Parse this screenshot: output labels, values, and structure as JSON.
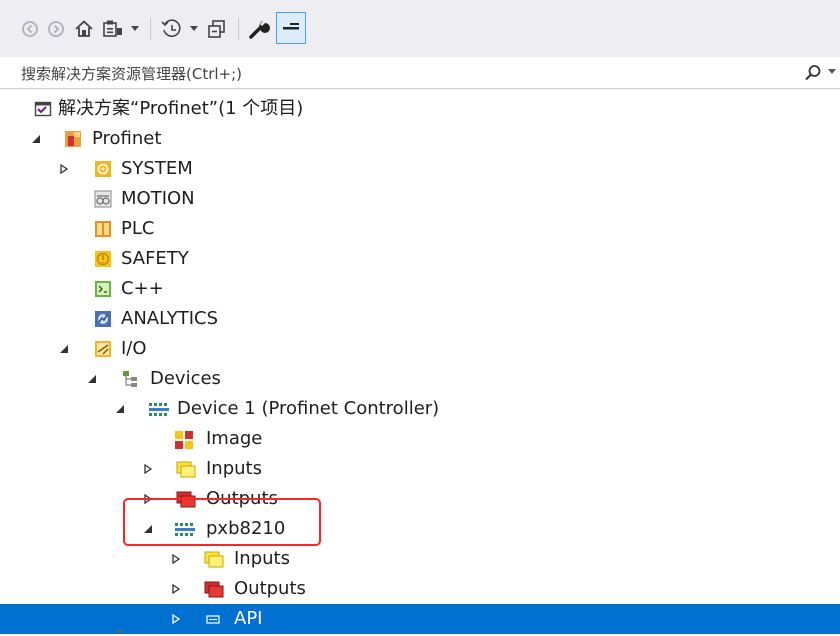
{
  "search": {
    "placeholder": "搜索解决方案资源管理器(Ctrl+;)"
  },
  "toolbar": {
    "buttons": [
      "back-icon",
      "forward-icon",
      "home-icon",
      "switch-views-icon",
      "pending-changes-icon",
      "collapse-all-icon",
      "properties-icon",
      "preview-icon"
    ]
  },
  "tree": [
    {
      "label": "解决方案“Profinet”(1 个项目)",
      "icon": "solution-icon",
      "expander": "none"
    },
    {
      "label": "Profinet",
      "icon": "project-icon",
      "expander": "expanded"
    },
    {
      "label": "SYSTEM",
      "icon": "system-icon",
      "expander": "collapsed"
    },
    {
      "label": "MOTION",
      "icon": "motion-icon",
      "expander": "none"
    },
    {
      "label": "PLC",
      "icon": "plc-icon",
      "expander": "none"
    },
    {
      "label": "SAFETY",
      "icon": "safety-icon",
      "expander": "none"
    },
    {
      "label": "C++",
      "icon": "cpp-icon",
      "expander": "none"
    },
    {
      "label": "ANALYTICS",
      "icon": "analytics-icon",
      "expander": "none"
    },
    {
      "label": "I/O",
      "icon": "io-icon",
      "expander": "expanded"
    },
    {
      "label": "Devices",
      "icon": "devices-icon",
      "expander": "expanded"
    },
    {
      "label": "Device 1 (Profinet Controller)",
      "icon": "profinet-device-icon",
      "expander": "expanded"
    },
    {
      "label": "Image",
      "icon": "image-icon",
      "expander": "none"
    },
    {
      "label": "Inputs",
      "icon": "inputs-icon",
      "expander": "collapsed"
    },
    {
      "label": "Outputs",
      "icon": "outputs-icon",
      "expander": "collapsed"
    },
    {
      "label": "pxb8210",
      "icon": "profinet-device-icon",
      "expander": "expanded"
    },
    {
      "label": "Inputs",
      "icon": "inputs-icon",
      "expander": "collapsed"
    },
    {
      "label": "Outputs",
      "icon": "outputs-icon",
      "expander": "collapsed"
    },
    {
      "label": "API",
      "icon": "api-icon",
      "expander": "collapsed",
      "selected": true
    }
  ],
  "colors": {
    "selection": "#0070d1",
    "callout": "#ff2525",
    "toolbar_bg": "#eeeef2"
  }
}
